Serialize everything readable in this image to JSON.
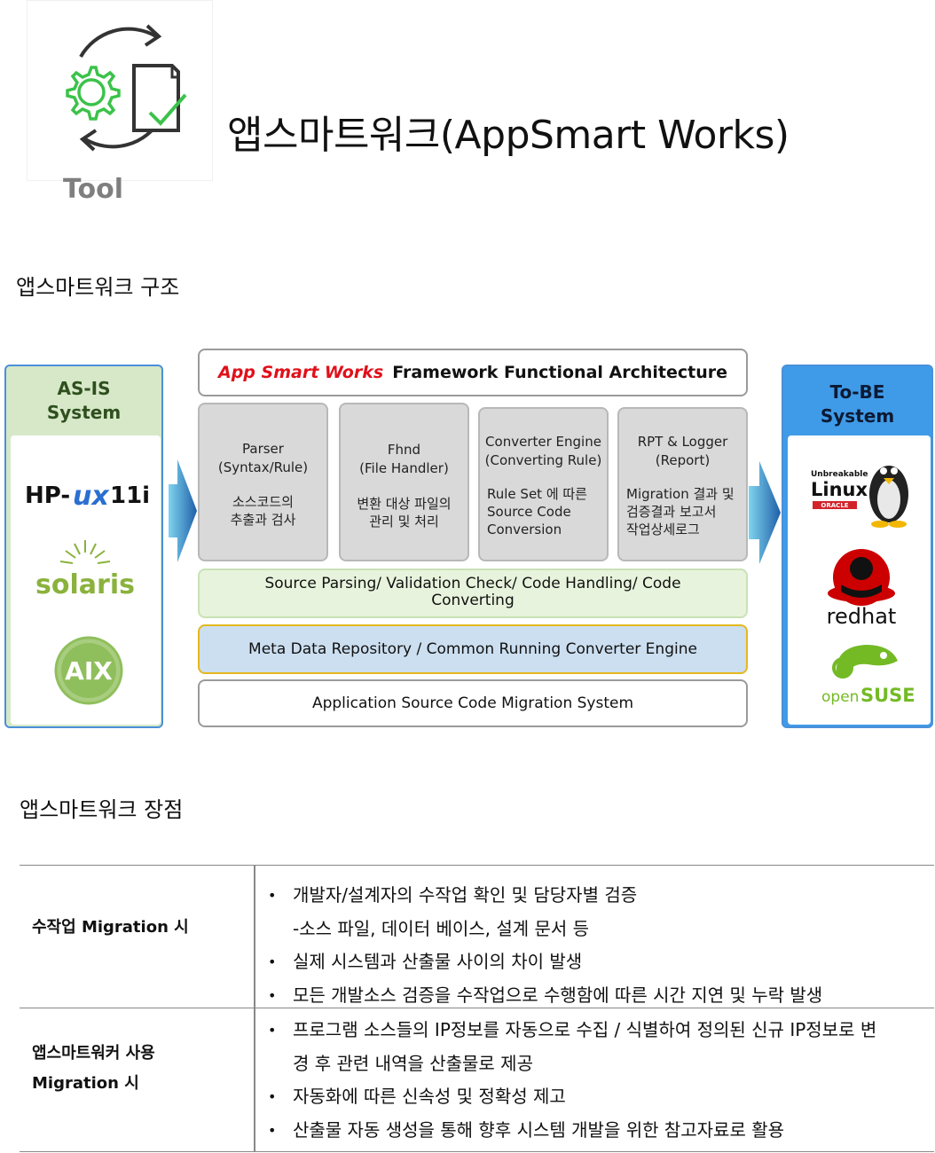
{
  "header": {
    "logo_caption": "Tool",
    "title": "앱스마트워크(AppSmart Works)"
  },
  "structure_section_title": "앱스마트워크 구조",
  "architecture": {
    "asis": {
      "title": "AS-IS\nSystem",
      "platforms": [
        "HP-UX 11i",
        "solaris",
        "AIX"
      ]
    },
    "tobe": {
      "title": "To-BE\nSystem",
      "platforms": [
        "Unbreakable Linux ORACLE",
        "redhat",
        "openSUSE"
      ]
    },
    "framework_title_accent": "App Smart Works",
    "framework_title_rest": "Framework Functional Architecture",
    "modules": [
      {
        "name": "Parser\n(Syntax/Rule)",
        "desc": "소스코드의\n추출과 검사"
      },
      {
        "name": "Fhnd\n(File Handler)",
        "desc": "변환 대상 파일의\n관리 및 처리"
      },
      {
        "name": "Converter Engine\n(Converting Rule)",
        "desc": "Rule Set 에 따른\nSource Code\nConversion"
      },
      {
        "name": "RPT   & Logger\n(Report)",
        "desc": "Migration 결과 및\n검증결과 보고서\n작업상세로그"
      }
    ],
    "bar_1": "Source Parsing/ Validation Check/ Code Handling/ Code\nConverting",
    "bar_2": "Meta Data Repository / Common Running Converter Engine",
    "bar_3": "Application Source Code Migration System",
    "colors": {
      "asis_bg": "#d6e8c8",
      "tobe_bg": "#3f9be8",
      "accent_red": "#e0101a",
      "panel_border": "#4a90d9"
    }
  },
  "advantages_section_title": "앱스마트워크 장점",
  "advantages": [
    {
      "label": "수작업 Migration 시",
      "items": [
        {
          "bullet": "•",
          "text": "개발자/설계자의 수작업 확인 및 담당자별 검증"
        },
        {
          "bullet": "",
          "text": "-소스 파일, 데이터 베이스, 설계 문서 등"
        },
        {
          "bullet": "•",
          "text": "실제 시스템과 산출물 사이의 차이 발생"
        },
        {
          "bullet": "•",
          "text": "모든 개발소스 검증을 수작업으로 수행함에 따른 시간 지연 및 누락 발생"
        }
      ]
    },
    {
      "label": "앱스마트워커 사용\nMigration 시",
      "items": [
        {
          "bullet": "•",
          "text": "프로그램 소스들의 IP정보를 자동으로 수집 / 식별하여 정의된 신규 IP정보로 변"
        },
        {
          "bullet": "",
          "text": "경 후 관련 내역을 산출물로 제공"
        },
        {
          "bullet": "•",
          "text": "자동화에 따른 신속성 및 정확성 제고"
        },
        {
          "bullet": "•",
          "text": "산출물 자동 생성을 통해 향후 시스템 개발을 위한 참고자료로 활용"
        }
      ]
    }
  ]
}
